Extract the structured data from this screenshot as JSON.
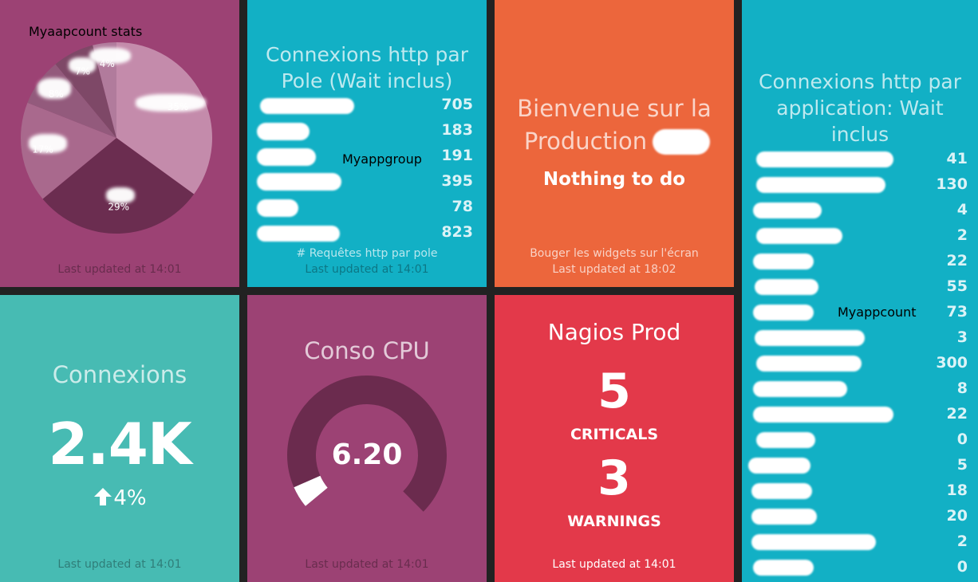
{
  "pie_tile": {
    "title": "Myaapcount stats",
    "updated": "Last updated at 14:01",
    "chart_data": {
      "type": "pie",
      "slices": [
        {
          "label": "35%",
          "value": 35,
          "color": "#c48bab"
        },
        {
          "label": "29%",
          "value": 29,
          "color": "#6b2d50"
        },
        {
          "label": "17%",
          "value": 17,
          "color": "#a9698d"
        },
        {
          "label": "8%",
          "value": 8,
          "color": "#935a7c"
        },
        {
          "label": "7%",
          "value": 7,
          "color": "#7e4867"
        },
        {
          "label": "4%",
          "value": 4,
          "color": "#b17b9c"
        }
      ]
    }
  },
  "pole_tile": {
    "title_line1": "Connexions http par",
    "title_line2": "Pole (Wait inclus)",
    "values": [
      "705",
      "183",
      "191",
      "395",
      "78",
      "823"
    ],
    "overlay_label": "Myappgroup",
    "moreinfo": "# Requêtes http par pole",
    "updated": "Last updated at 14:01"
  },
  "welcome_tile": {
    "title_line1": "Bienvenue sur la",
    "title_line2": "Production",
    "subtitle": "Nothing to do",
    "moreinfo": "Bouger les widgets sur l'écran",
    "updated": "Last updated at 18:02"
  },
  "app_tile": {
    "title_line1": "Connexions http par",
    "title_line2": "application: Wait",
    "title_line3": "inclus",
    "values": [
      "41",
      "130",
      "4",
      "2",
      "22",
      "55",
      "73",
      "3",
      "300",
      "8",
      "22",
      "0",
      "5",
      "18",
      "20",
      "2",
      "0"
    ],
    "overlay_label": "Myappcount"
  },
  "connexions_tile": {
    "title": "Connexions",
    "value": "2.4K",
    "change": "4%",
    "arrow_icon": "arrow-up-icon",
    "updated": "Last updated at 14:01"
  },
  "cpu_tile": {
    "title": "Conso CPU",
    "value": "6.20",
    "gauge_fraction": 0.06,
    "updated": "Last updated at 14:01"
  },
  "nagios_tile": {
    "title": "Nagios Prod",
    "criticals_value": "5",
    "criticals_label": "CRITICALS",
    "warnings_value": "3",
    "warnings_label": "WARNINGS",
    "updated": "Last updated at 14:01"
  }
}
